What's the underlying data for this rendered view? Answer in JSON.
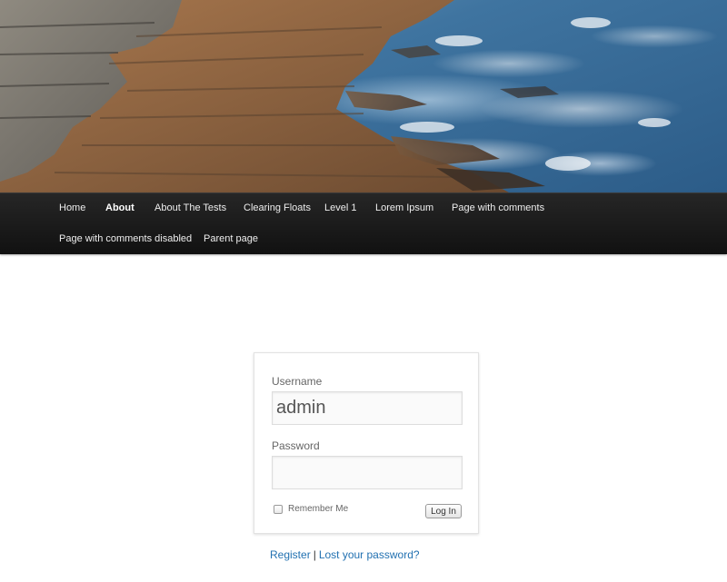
{
  "nav": {
    "items": [
      {
        "label": "Home",
        "active": false
      },
      {
        "label": "About",
        "active": true
      },
      {
        "label": "About The Tests",
        "active": false
      },
      {
        "label": "Clearing Floats",
        "active": false
      },
      {
        "label": "Level 1",
        "active": false
      },
      {
        "label": "Lorem Ipsum",
        "active": false
      },
      {
        "label": "Page with comments",
        "active": false
      },
      {
        "label": "Page with comments disabled",
        "active": false
      },
      {
        "label": "Parent page",
        "active": false
      }
    ]
  },
  "login": {
    "username_label": "Username",
    "username_value": "admin",
    "password_label": "Password",
    "password_value": "",
    "remember_label": "Remember Me",
    "remember_checked": false,
    "submit_label": "Log In"
  },
  "links": {
    "register": "Register",
    "separator": "|",
    "lost_password": "Lost your password?"
  },
  "colors": {
    "nav_background": "#1a1a1a",
    "link": "#2271b1"
  }
}
